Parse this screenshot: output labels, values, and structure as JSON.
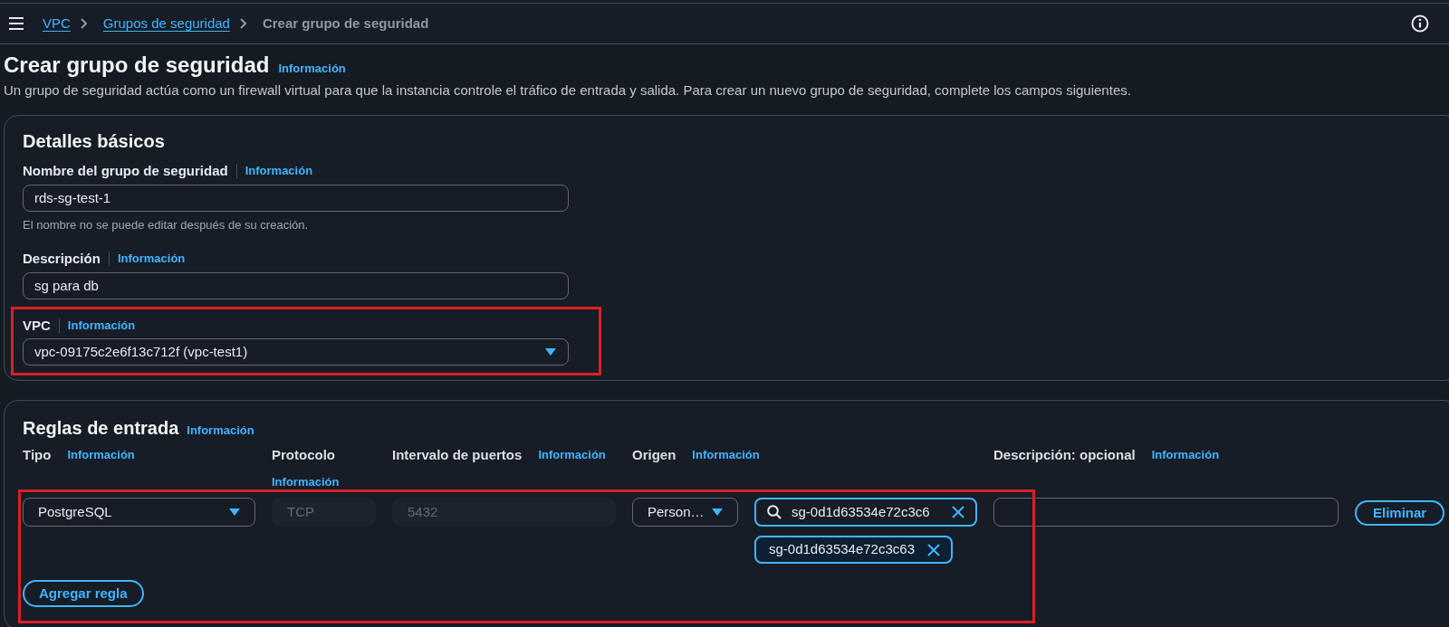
{
  "top_bar": {
    "breadcrumbs": [
      {
        "label": "VPC",
        "kind": "link"
      },
      {
        "label": "Grupos de seguridad",
        "kind": "link"
      },
      {
        "label": "Crear grupo de seguridad",
        "kind": "current"
      }
    ]
  },
  "header": {
    "title": "Crear grupo de seguridad",
    "info_link": "Información",
    "description": "Un grupo de seguridad actúa como un firewall virtual para que la instancia controle el tráfico de entrada y salida. Para crear un nuevo grupo de seguridad, complete los campos siguientes."
  },
  "basic_details": {
    "title": "Detalles básicos",
    "fields": [
      {
        "kind": "text",
        "label": "Nombre del grupo de seguridad",
        "info_link": "Información",
        "value": "rds-sg-test-1",
        "hint": "El nombre no se puede editar después de su creación.",
        "highlighted": false
      },
      {
        "kind": "text",
        "label": "Descripción",
        "info_link": "Información",
        "value": "sg para db",
        "highlighted": false
      },
      {
        "kind": "select",
        "label": "VPC",
        "info_link": "Información",
        "value": "vpc-09175c2e6f13c712f (vpc-test1)",
        "highlighted": true
      }
    ]
  },
  "inbound_rules": {
    "title": "Reglas de entrada",
    "info_link": "Información",
    "highlighted": true,
    "columns": [
      {
        "label": "Tipo",
        "info_link": "Información"
      },
      {
        "label": "Protocolo",
        "info_link": "Información"
      },
      {
        "label": "Intervalo de puertos",
        "info_link": "Información"
      },
      {
        "label": "Origen",
        "info_link": "Información"
      },
      {
        "label": "Descripción: opcional",
        "info_link": "Información"
      }
    ],
    "rows": [
      {
        "cells": [
          {
            "kind": "select",
            "value": "PostgreSQL"
          },
          {
            "kind": "text",
            "value": "TCP",
            "disabled": true
          },
          {
            "kind": "text",
            "value": "5432",
            "disabled": true
          },
          {
            "kind": "select",
            "value": "Person…"
          },
          {
            "kind": "search",
            "value": "sg-0d1d63534e72c3c6",
            "tokens": [
              "sg-0d1d63534e72c3c63"
            ]
          },
          {
            "kind": "text",
            "disabled": false
          }
        ],
        "remove_button": "Eliminar"
      }
    ],
    "add_button": "Agregar regla"
  }
}
